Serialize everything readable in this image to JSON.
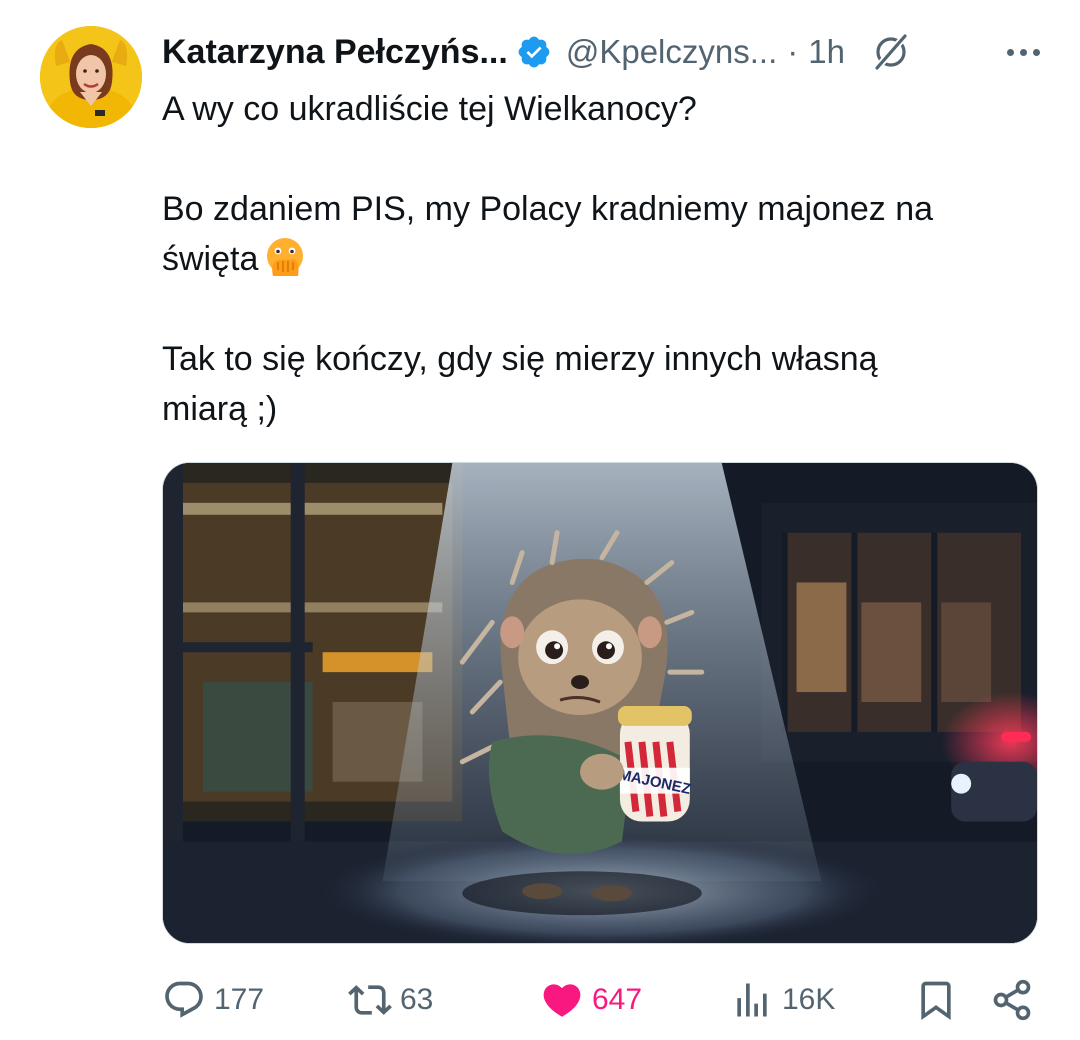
{
  "author": {
    "name": "Katarzyna Pełczyńs...",
    "handle": "@Kpelczyns...",
    "separator": "·",
    "time": "1h"
  },
  "tweet": {
    "line1": "A wy co ukradliście tej Wielkanocy?",
    "line2": "Bo zdaniem PIS, my Polacy kradniemy majonez na",
    "line3": "święta",
    "line4": "Tak to się kończy, gdy się mierzy innych własną",
    "line5": "miarą ;)"
  },
  "media": {
    "jar_label": "MAJONEZ"
  },
  "actions": {
    "replies": "177",
    "reposts": "63",
    "likes": "647",
    "views": "16K"
  },
  "icons": {
    "verified": "verified-badge-icon",
    "grok": "grok-icon",
    "more": "more-icon",
    "reply": "reply-icon",
    "repost": "repost-icon",
    "like": "heart-icon",
    "views": "views-icon",
    "bookmark": "bookmark-icon",
    "share": "share-icon",
    "emoji": "face-with-open-eyes-and-hand-over-mouth-emoji"
  },
  "colors": {
    "text": "#0f1419",
    "secondary": "#536471",
    "verified": "#1d9bf0",
    "like": "#f91880"
  }
}
